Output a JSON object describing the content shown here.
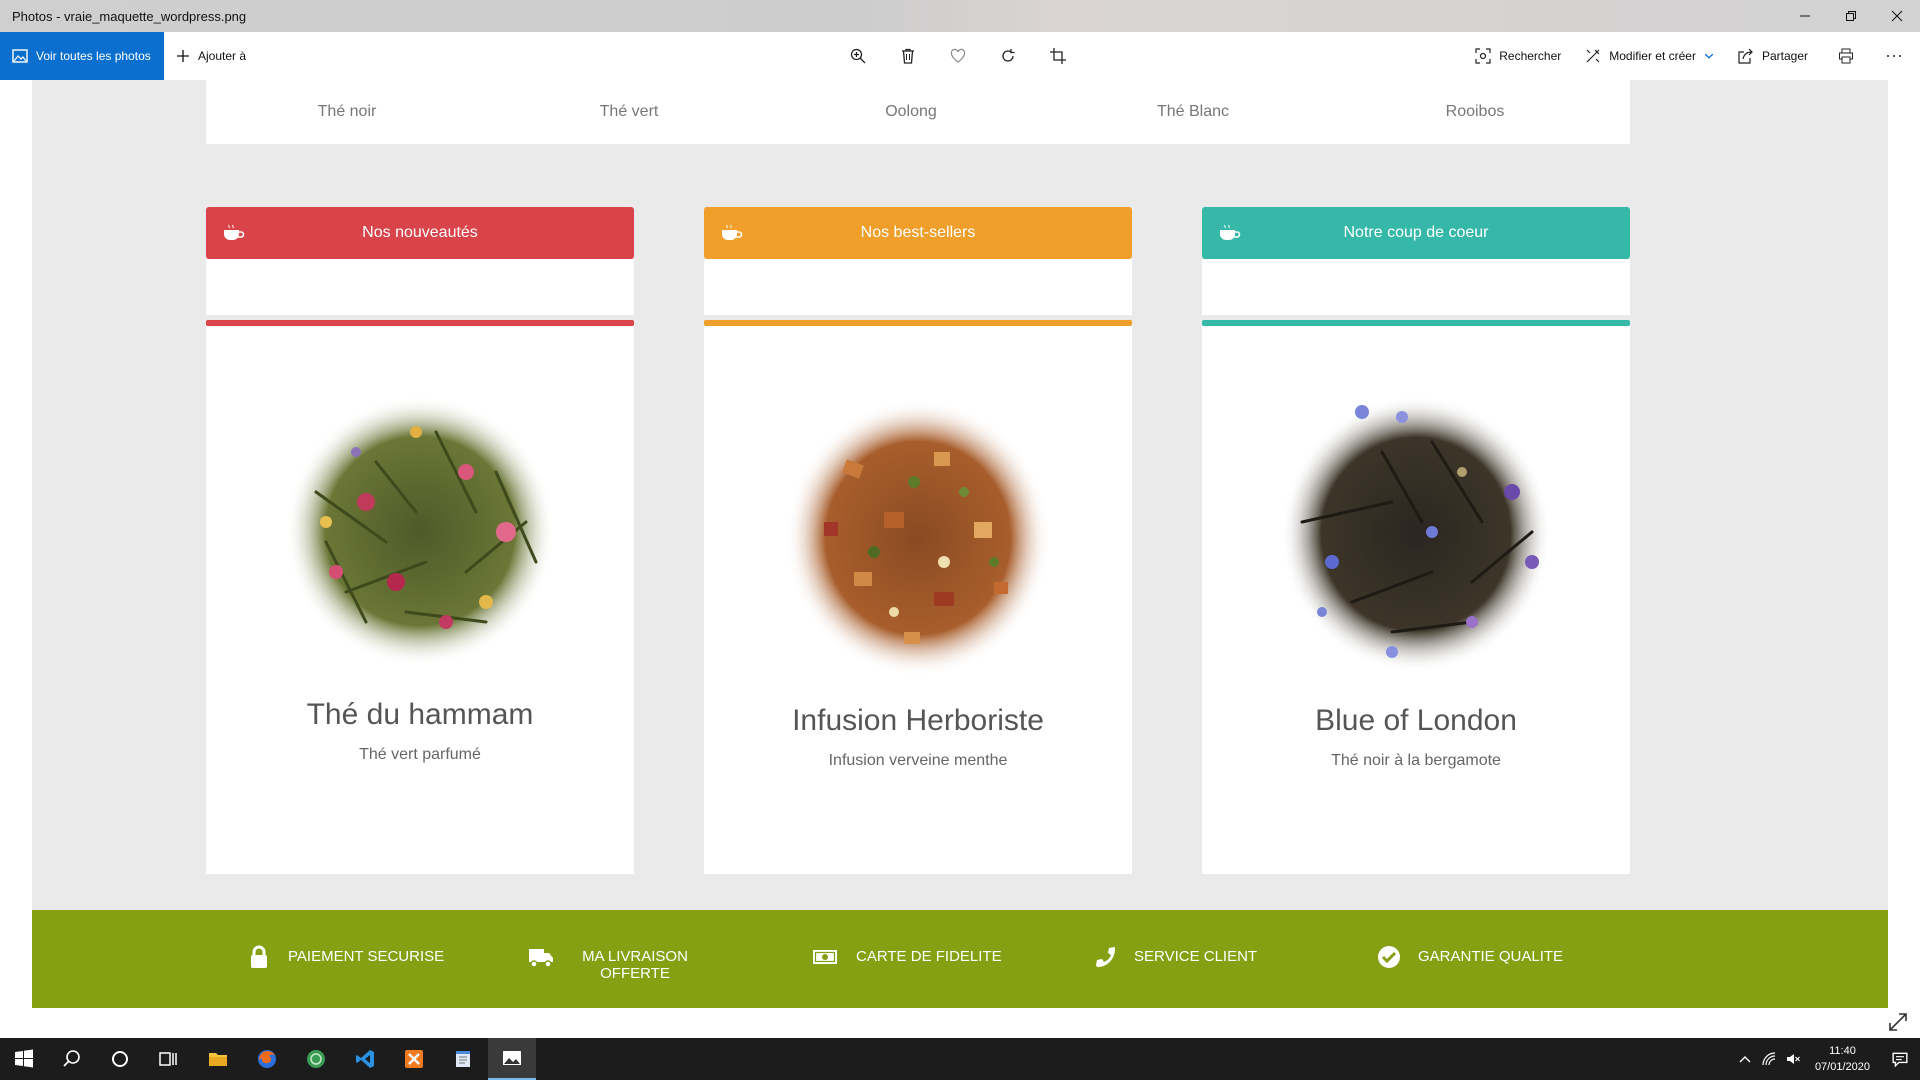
{
  "window": {
    "title": "Photos - vraie_maquette_wordpress.png"
  },
  "toolbar": {
    "view_all_label": "Voir toutes les photos",
    "add_label": "Ajouter à",
    "search_label": "Rechercher",
    "edit_label": "Modifier et créer",
    "share_label": "Partager"
  },
  "categories": [
    "Thé noir",
    "Thé vert",
    "Oolong",
    "Thé Blanc",
    "Rooibos"
  ],
  "cards": [
    {
      "header": "Nos nouveautés",
      "color": "#d9434a",
      "name": "Thé du hammam",
      "desc": "Thé vert parfumé",
      "image": "green-tea-rose-petals"
    },
    {
      "header": "Nos best-sellers",
      "color": "#f0a02a",
      "name": "Infusion Herboriste",
      "desc": "Infusion verveine menthe",
      "image": "herbal-fruit-infusion"
    },
    {
      "header": "Notre coup de coeur",
      "color": "#35b8a8",
      "name": "Blue of London",
      "desc": "Thé noir à la bergamote",
      "image": "black-tea-cornflower"
    }
  ],
  "features": [
    {
      "label": "PAIEMENT SECURISE",
      "icon": "lock-icon"
    },
    {
      "label": "MA LIVRAISON OFFERTE",
      "icon": "truck-icon"
    },
    {
      "label": "CARTE DE FIDELITE",
      "icon": "money-icon"
    },
    {
      "label": "SERVICE CLIENT",
      "icon": "phone-icon"
    },
    {
      "label": "GARANTIE QUALITE",
      "icon": "check-circle-icon"
    }
  ],
  "taskbar": {
    "time": "11:40",
    "date": "07/01/2020"
  },
  "colors": {
    "accent": "#0a6fcf",
    "footer_green": "#86a013",
    "page_bg": "#eaeaea"
  }
}
